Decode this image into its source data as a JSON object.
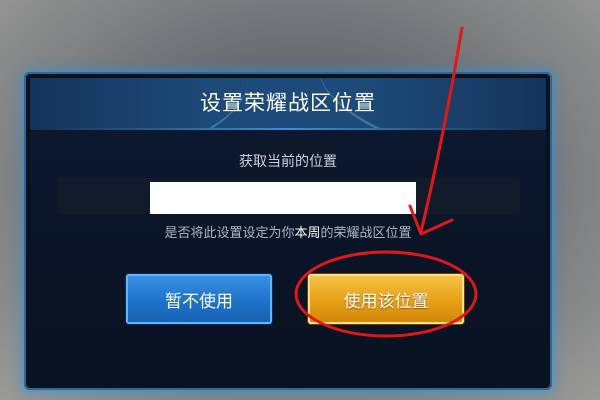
{
  "dialog": {
    "title": "设置荣耀战区位置",
    "current_location_label": "获取当前的位置",
    "location_value": "",
    "confirm_prefix": "是否将此设置设定为你",
    "confirm_highlight": "本周",
    "confirm_suffix": "的荣耀战区位置",
    "cancel_button": "暂不使用",
    "use_button": "使用该位置"
  },
  "colors": {
    "header_blue": "#1d4a78",
    "cancel_blue": "#2074cc",
    "use_gold": "#e8a21a",
    "annotation_red": "#e01818"
  },
  "annotation": {
    "arrow_target": "use-location-button",
    "circle_target": "use-location-button"
  }
}
